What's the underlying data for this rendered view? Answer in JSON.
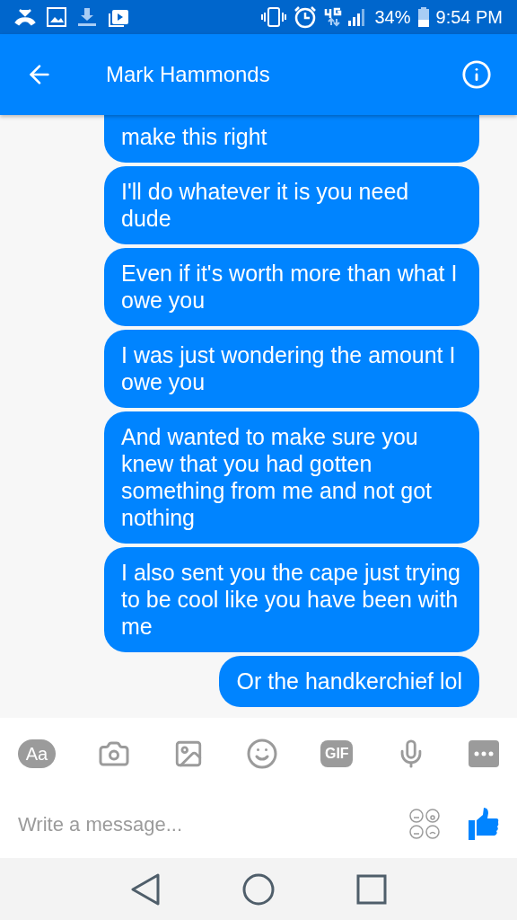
{
  "status_bar": {
    "battery": "34%",
    "time": "9:54 PM"
  },
  "header": {
    "title": "Mark Hammonds"
  },
  "messages": [
    {
      "text": "make this right"
    },
    {
      "text": "I'll do whatever it is you need dude"
    },
    {
      "text": "Even if it's worth more than what I owe you"
    },
    {
      "text": "I was just wondering the amount I owe you"
    },
    {
      "text": "And wanted to make sure you knew that you had gotten something from me and not got nothing"
    },
    {
      "text": "I also sent you the cape just trying to be cool like you have been with me"
    },
    {
      "text": "Or the handkerchief lol"
    }
  ],
  "toolbar": {
    "text_button": "Aa",
    "gif_button": "GIF"
  },
  "composer": {
    "placeholder": "Write a message..."
  }
}
